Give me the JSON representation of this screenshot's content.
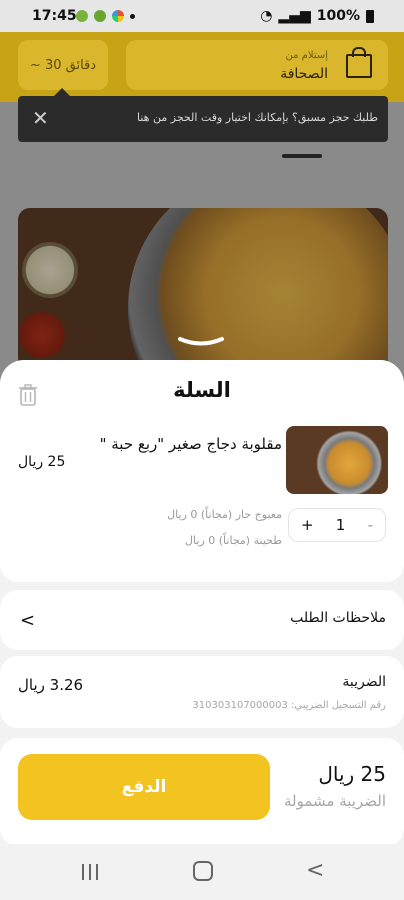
{
  "status_bar": {
    "time": "17:45",
    "battery": "100%"
  },
  "header": {
    "time_estimate": "~ 30 دقائق",
    "pickup_label": "إستلام من",
    "pickup_value": "الصحافة"
  },
  "toast": {
    "message": "طلبك حجز مسبق؟ بإمكانك اختيار وقت الحجز من هنا"
  },
  "cart": {
    "title": "السلة",
    "item": {
      "name": "مقلوبة دجاج صغير \"ربع حبة \"",
      "price": "25 ريال",
      "addons": [
        "معبوج حار (مجاناً) 0 ريال",
        "طحينة (مجاناً) 0 ريال"
      ],
      "quantity": "1",
      "minus": "-",
      "plus": "+"
    },
    "notes_label": "ملاحظات الطلب",
    "tax": {
      "label": "الضريبة",
      "vat_number": "رقم التسجيل الضريبي: 310303107000003",
      "value": "3.26 ريال"
    },
    "checkout": {
      "pay_label": "الدفع",
      "total": "25 ريال",
      "total_note": "الضريبة مشمولة"
    }
  },
  "icons": {
    "trash": "trash-icon",
    "close": "close-icon",
    "chevron_left": "chevron-left-icon",
    "bag": "bag-icon"
  },
  "colors": {
    "accent": "#f2c321"
  }
}
